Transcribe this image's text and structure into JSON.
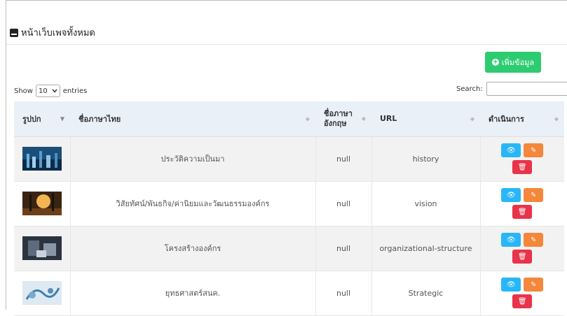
{
  "page": {
    "title": "หน้าเว็บเพจทั้งหมด"
  },
  "toolbar": {
    "add_label": "เพิ่มข้อมูล"
  },
  "length": {
    "show": "Show",
    "value": "10",
    "entries": "entries"
  },
  "search": {
    "label": "Search:",
    "value": ""
  },
  "columns": [
    "รูปปก",
    "ชื่อภาษาไทย",
    "ชื่อภาษาอังกฤษ",
    "URL",
    "ดำเนินการ"
  ],
  "rows": [
    {
      "name_th": "ประวัติความเป็นมา",
      "name_en": "null",
      "url": "history"
    },
    {
      "name_th": "วิสัยทัศน์/พันธกิจ/ค่านิยมและวัฒนธรรมองค์กร",
      "name_en": "null",
      "url": "vision"
    },
    {
      "name_th": "โครงสร้างองค์กร",
      "name_en": "null",
      "url": "organizational-structure"
    },
    {
      "name_th": "ยุทธศาสตร์สนค.",
      "name_en": "null",
      "url": "Strategic"
    }
  ],
  "colors": {
    "add": "#2ecc71",
    "view": "#29b6f6",
    "edit": "#f5873b",
    "delete": "#e8334a",
    "header_bg": "#eaf0f8"
  },
  "icons": {
    "title": "page-icon",
    "add": "plus-circle-icon",
    "view": "eye-icon",
    "edit": "edit-icon",
    "delete": "trash-icon",
    "length": "chevron-down-icon"
  }
}
